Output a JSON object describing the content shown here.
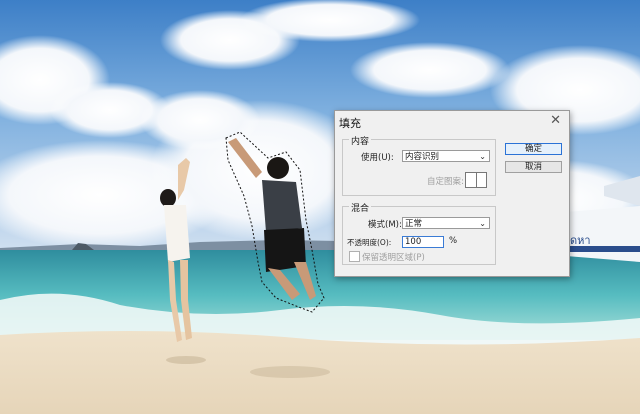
{
  "dialog": {
    "title": "填充",
    "close_glyph": "✕",
    "contents_group": {
      "label": "内容",
      "use_label": "使用(U):",
      "use_value": "内容识别",
      "pattern_label": "自定图案:"
    },
    "blending_group": {
      "label": "混合",
      "mode_label": "模式(M):",
      "mode_value": "正常",
      "opacity_label": "不透明度(O):",
      "opacity_value": "100",
      "opacity_unit": "%",
      "preserve_label": "保留透明区域(P)"
    },
    "buttons": {
      "ok": "确定",
      "cancel": "取消"
    }
  },
  "scene": {
    "boat_text": "ุดหา"
  },
  "icons": {
    "dropdown": "chevron-down-icon",
    "close": "close-icon"
  }
}
